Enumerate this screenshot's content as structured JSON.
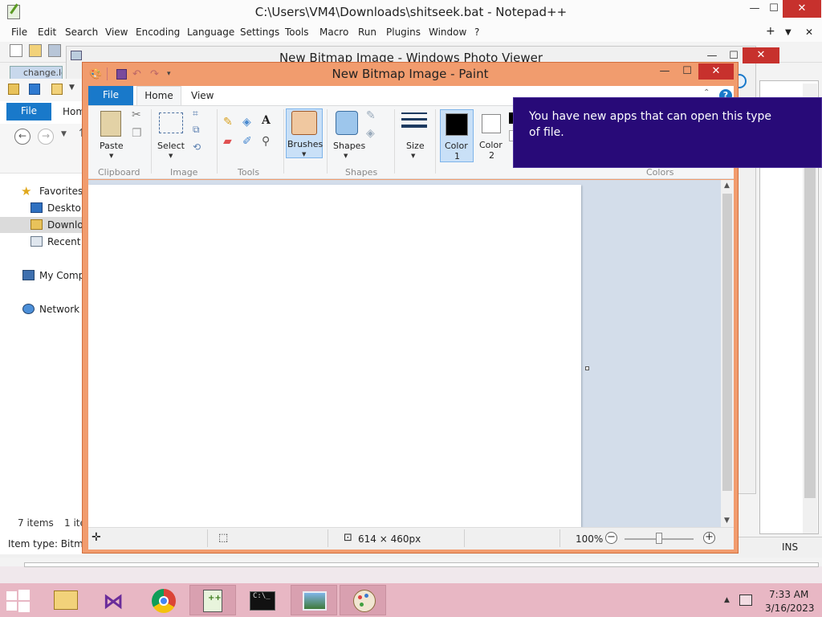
{
  "notepadpp": {
    "title": "C:\\Users\\VM4\\Downloads\\shitseek.bat - Notepad++",
    "menu": [
      "File",
      "Edit",
      "Search",
      "View",
      "Encoding",
      "Language",
      "Settings",
      "Tools",
      "Macro",
      "Run",
      "Plugins",
      "Window",
      "?"
    ],
    "tab": "change.lo",
    "status_ins": "INS",
    "window_controls": {
      "minimize": "—",
      "maximize": "☐",
      "close": "✕"
    }
  },
  "photo_viewer": {
    "title": "New Bitmap Image - Windows Photo Viewer"
  },
  "explorer": {
    "file_tab": "File",
    "home_tab": "Hom",
    "nav": [
      {
        "label": "Favorites",
        "icon": "star-icon"
      },
      {
        "label": "Desktop",
        "icon": "desktop-icon"
      },
      {
        "label": "Downloa",
        "icon": "downloads-icon"
      },
      {
        "label": "Recent p",
        "icon": "recent-places-icon"
      },
      {
        "label": "My Comp",
        "icon": "computer-icon"
      },
      {
        "label": "Network",
        "icon": "network-icon"
      }
    ],
    "item_count": "7 items",
    "selected_count": "1 ite",
    "item_type": "Item type: Bitmap"
  },
  "paint": {
    "title": "New Bitmap Image - Paint",
    "tabs": {
      "file": "File",
      "home": "Home",
      "view": "View"
    },
    "ribbon": {
      "paste": "Paste",
      "select": "Select",
      "brushes": "Brushes",
      "shapes": "Shapes",
      "size": "Size",
      "color1": "Color",
      "color1_num": "1",
      "color2": "Color",
      "color2_num": "2",
      "groups": {
        "clipboard": "Clipboard",
        "image": "Image",
        "tools": "Tools",
        "shapes": "Shapes",
        "colors": "Colors"
      }
    },
    "status": {
      "dimensions": "614 × 460px",
      "zoom": "100%"
    },
    "colors": {
      "accent": "#1979ca",
      "frame": "#f19c6e",
      "color1": "#000000",
      "color2": "#ffffff"
    }
  },
  "toast": {
    "message": "You have new apps that can open this type of file."
  },
  "taskbar": {
    "apps": [
      "file-explorer-icon",
      "visual-studio-icon",
      "chrome-icon",
      "notepadpp-icon",
      "command-prompt-icon",
      "photo-viewer-icon",
      "paint-icon"
    ],
    "time": "7:33 AM",
    "date": "3/16/2023"
  }
}
